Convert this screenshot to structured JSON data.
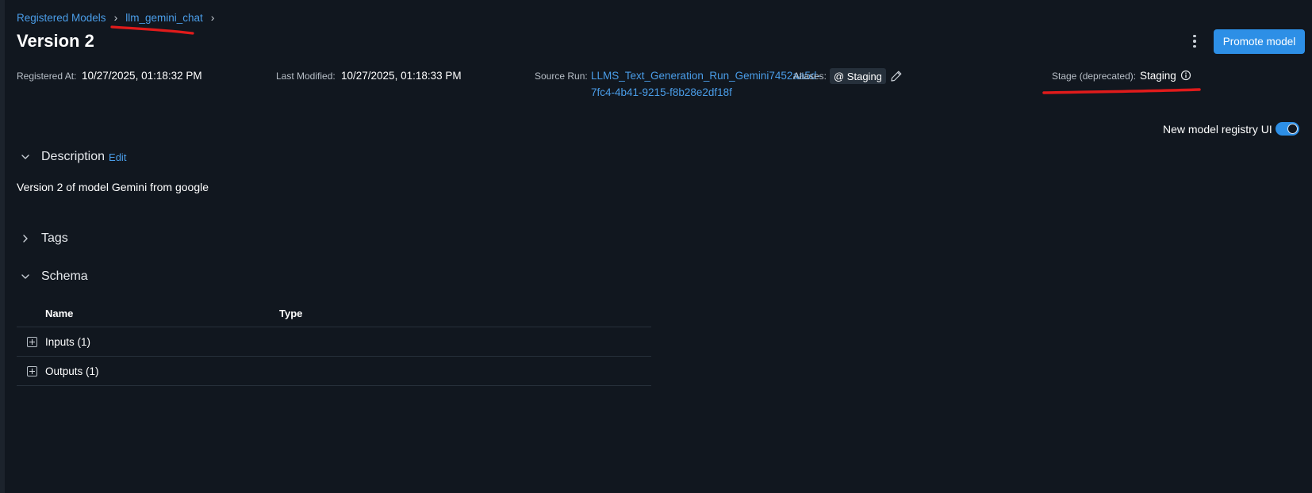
{
  "breadcrumb": {
    "root": "Registered Models",
    "model": "llm_gemini_chat"
  },
  "page": {
    "title": "Version 2",
    "promote_label": "Promote model"
  },
  "metadata": {
    "registered_at_label": "Registered At:",
    "registered_at_value": "10/27/2025, 01:18:32 PM",
    "last_modified_label": "Last Modified:",
    "last_modified_value": "10/27/2025, 01:18:33 PM",
    "source_run_label": "Source Run:",
    "source_run_line1": "LLMS_Text_Generation_Run_Gemini7452aa5d-",
    "source_run_line2": "7fc4-4b41-9215-f8b28e2df18f",
    "aliases_label": "Aliases:",
    "alias_chip": "@ Staging",
    "stage_label": "Stage (deprecated):",
    "stage_value": "Staging"
  },
  "toggle": {
    "label": "New model registry UI",
    "enabled": true
  },
  "description": {
    "title": "Description",
    "edit_label": "Edit",
    "text": "Version 2 of model Gemini from google"
  },
  "tags": {
    "title": "Tags"
  },
  "schema": {
    "title": "Schema",
    "columns": [
      "Name",
      "Type"
    ],
    "rows": [
      {
        "name": "Inputs (1)",
        "type": ""
      },
      {
        "name": "Outputs (1)",
        "type": ""
      }
    ]
  },
  "colors": {
    "background": "#11171f",
    "link": "#4a9de8",
    "primary_button": "#2d8fe6",
    "annotation_red": "#e01b1b"
  },
  "icons": {
    "kebab": "kebab-menu-icon",
    "edit": "pencil-icon",
    "info": "info-icon",
    "collapse": "chevron-down-icon",
    "expand": "chevron-right-icon",
    "row_expand": "plus-square-icon"
  }
}
